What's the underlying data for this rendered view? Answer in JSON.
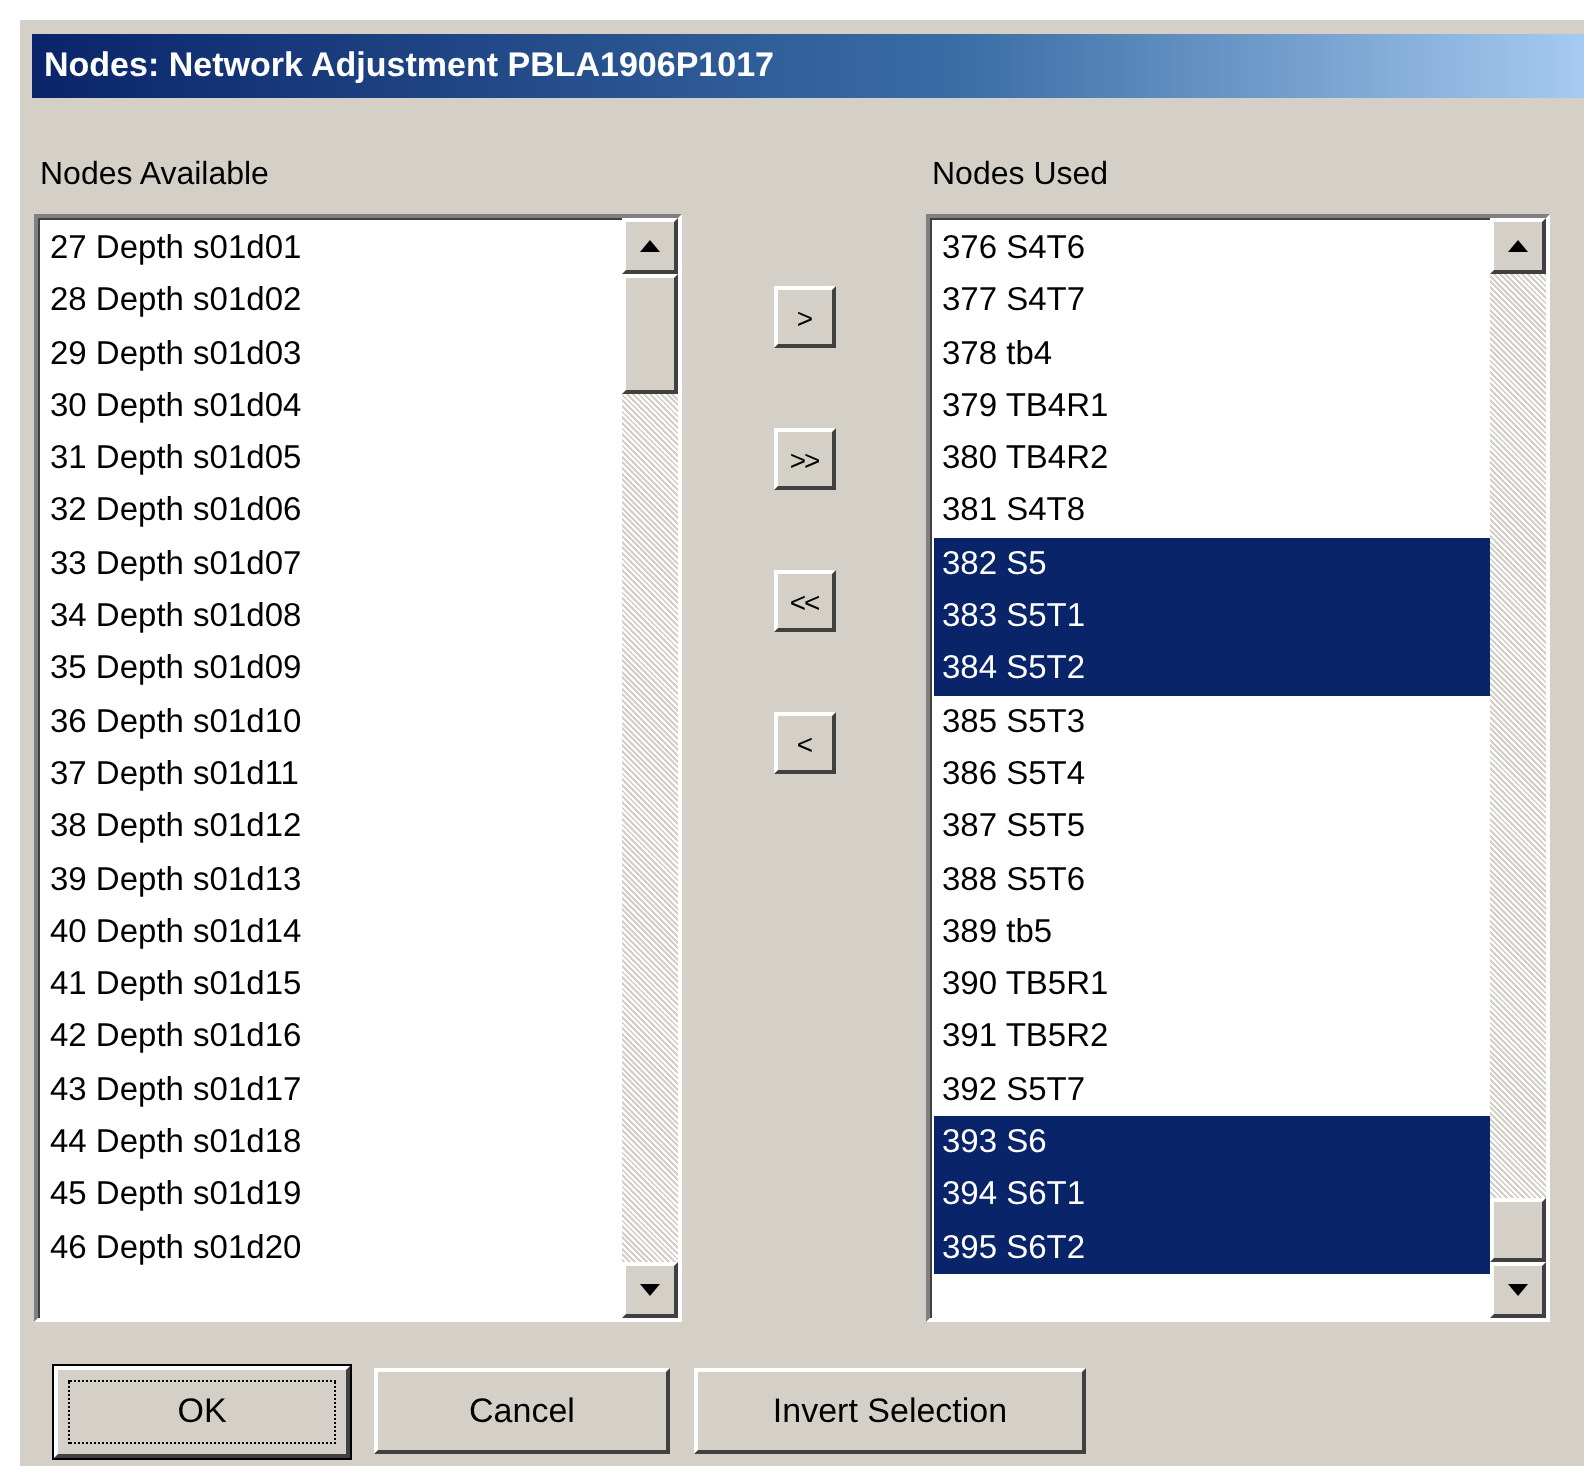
{
  "window": {
    "title": "Nodes: Network Adjustment PBLA1906P1017"
  },
  "available": {
    "label": "Nodes Available",
    "items": [
      {
        "text": "27 Depth s01d01",
        "selected": false
      },
      {
        "text": "28 Depth s01d02",
        "selected": false
      },
      {
        "text": "29 Depth s01d03",
        "selected": false
      },
      {
        "text": "30 Depth s01d04",
        "selected": false
      },
      {
        "text": "31 Depth s01d05",
        "selected": false
      },
      {
        "text": "32 Depth s01d06",
        "selected": false
      },
      {
        "text": "33 Depth s01d07",
        "selected": false
      },
      {
        "text": "34 Depth s01d08",
        "selected": false
      },
      {
        "text": "35 Depth s01d09",
        "selected": false
      },
      {
        "text": "36 Depth s01d10",
        "selected": false
      },
      {
        "text": "37 Depth s01d11",
        "selected": false
      },
      {
        "text": "38 Depth s01d12",
        "selected": false
      },
      {
        "text": "39 Depth s01d13",
        "selected": false
      },
      {
        "text": "40 Depth s01d14",
        "selected": false
      },
      {
        "text": "41 Depth s01d15",
        "selected": false
      },
      {
        "text": "42 Depth s01d16",
        "selected": false
      },
      {
        "text": "43 Depth s01d17",
        "selected": false
      },
      {
        "text": "44 Depth s01d18",
        "selected": false
      },
      {
        "text": "45 Depth s01d19",
        "selected": false
      },
      {
        "text": "46 Depth s01d20",
        "selected": false
      }
    ]
  },
  "transfer_buttons": [
    ">",
    ">>",
    "<<",
    "<"
  ],
  "used": {
    "label": "Nodes Used",
    "items": [
      {
        "text": "376 S4T6",
        "selected": false
      },
      {
        "text": "377 S4T7",
        "selected": false
      },
      {
        "text": "378 tb4",
        "selected": false
      },
      {
        "text": "379 TB4R1",
        "selected": false
      },
      {
        "text": "380 TB4R2",
        "selected": false
      },
      {
        "text": "381 S4T8",
        "selected": false
      },
      {
        "text": "382 S5",
        "selected": true
      },
      {
        "text": "383 S5T1",
        "selected": true
      },
      {
        "text": "384 S5T2",
        "selected": true
      },
      {
        "text": "385 S5T3",
        "selected": false
      },
      {
        "text": "386 S5T4",
        "selected": false
      },
      {
        "text": "387 S5T5",
        "selected": false
      },
      {
        "text": "388 S5T6",
        "selected": false
      },
      {
        "text": "389 tb5",
        "selected": false
      },
      {
        "text": "390 TB5R1",
        "selected": false
      },
      {
        "text": "391 TB5R2",
        "selected": false
      },
      {
        "text": "392 S5T7",
        "selected": false
      },
      {
        "text": "393 S6",
        "selected": true
      },
      {
        "text": "394 S6T1",
        "selected": true
      },
      {
        "text": "395 S6T2",
        "selected": true
      }
    ]
  },
  "buttons": [
    {
      "label": "OK",
      "default": true
    },
    {
      "label": "Cancel",
      "default": false
    },
    {
      "label": "Invert Selection",
      "default": false
    }
  ]
}
